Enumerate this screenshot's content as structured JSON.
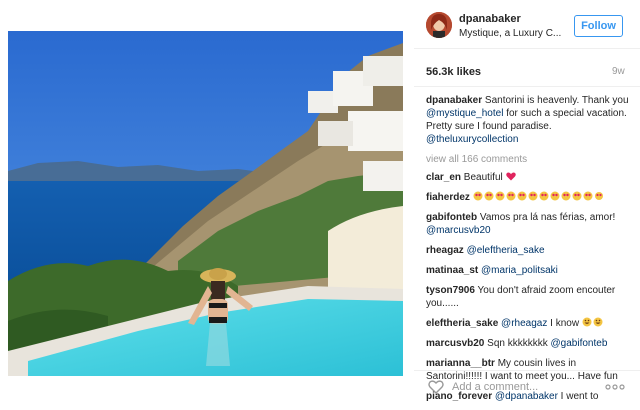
{
  "header": {
    "username": "dpanabaker",
    "location": "Mystique, a Luxury C...",
    "follow_label": "Follow"
  },
  "stats": {
    "likes": "56.3k likes",
    "time": "9w"
  },
  "caption": {
    "user": "dpanabaker",
    "text_1": " Santorini is heavenly. Thank you ",
    "tag_1": "@mystique_hotel",
    "text_2": " for such a special vacation. Pretty sure I found paradise. ",
    "tag_2": "@theluxurycollection"
  },
  "view_all": "view all 166 comments",
  "comments": [
    {
      "user": "clar_en",
      "text": " Beautiful "
    },
    {
      "user": "fiaherdez",
      "text": " "
    },
    {
      "user": "gabifonteb",
      "text": " Vamos pra lá nas férias, amor! ",
      "tag": "@marcusvb20"
    },
    {
      "user": "rheagaz",
      "tag": " @eleftheria_sake"
    },
    {
      "user": "matinaa_st",
      "tag": " @maria_politsaki"
    },
    {
      "user": "tyson7906",
      "text": " You don't afraid zoom encouter you......"
    },
    {
      "user": "eleftheria_sake",
      "tag": " @rheagaz",
      "text": " I know "
    },
    {
      "user": "marcusvb20",
      "text": " Sqn kkkkkkkk ",
      "tag": "@gabifonteb"
    },
    {
      "user": "marianna__btr",
      "text": " My cousin lives in Santorini!!!!!! I want to meet you... Have fun"
    },
    {
      "user": "piano_forever",
      "tag": " @dpanabaker",
      "text": " I went to"
    }
  ],
  "add_comment": {
    "placeholder": "Add a comment..."
  },
  "icons": {
    "like": "heart-outline-icon",
    "more": "more-horizontal-icon",
    "heart_emoji": "red-heart-emoji",
    "love_face_emoji": "heart-eyes-emoji",
    "grin_emoji": "grinning-emoji"
  },
  "colors": {
    "link": "#003569",
    "follow": "#3897f0",
    "muted": "#999999"
  }
}
